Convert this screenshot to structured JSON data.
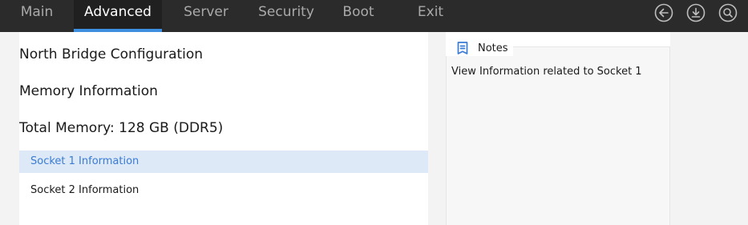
{
  "tabs": [
    {
      "label": "Main",
      "active": false
    },
    {
      "label": "Advanced",
      "active": true
    },
    {
      "label": "Server",
      "active": false
    },
    {
      "label": "Security",
      "active": false
    },
    {
      "label": "Boot",
      "active": false
    },
    {
      "label": "Exit",
      "active": false
    }
  ],
  "toolbar": {
    "icons": [
      "back-arrow-icon",
      "download-icon",
      "search-icon"
    ]
  },
  "main": {
    "section_title": "North Bridge Configuration",
    "subsection_title": "Memory Information",
    "total_memory": "Total Memory: 128 GB (DDR5)",
    "options": [
      {
        "label": "Socket 1 Information",
        "selected": true
      },
      {
        "label": "Socket 2 Information",
        "selected": false
      }
    ]
  },
  "notes": {
    "title": "Notes",
    "icon": "notes-icon",
    "text": "View Information related to Socket 1"
  },
  "colors": {
    "topbar_bg": "#2b2b2b",
    "active_tab_bg": "#202020",
    "accent": "#3f8fe0",
    "selected_bg": "#dde9f7",
    "selected_text": "#3a7bd5"
  }
}
